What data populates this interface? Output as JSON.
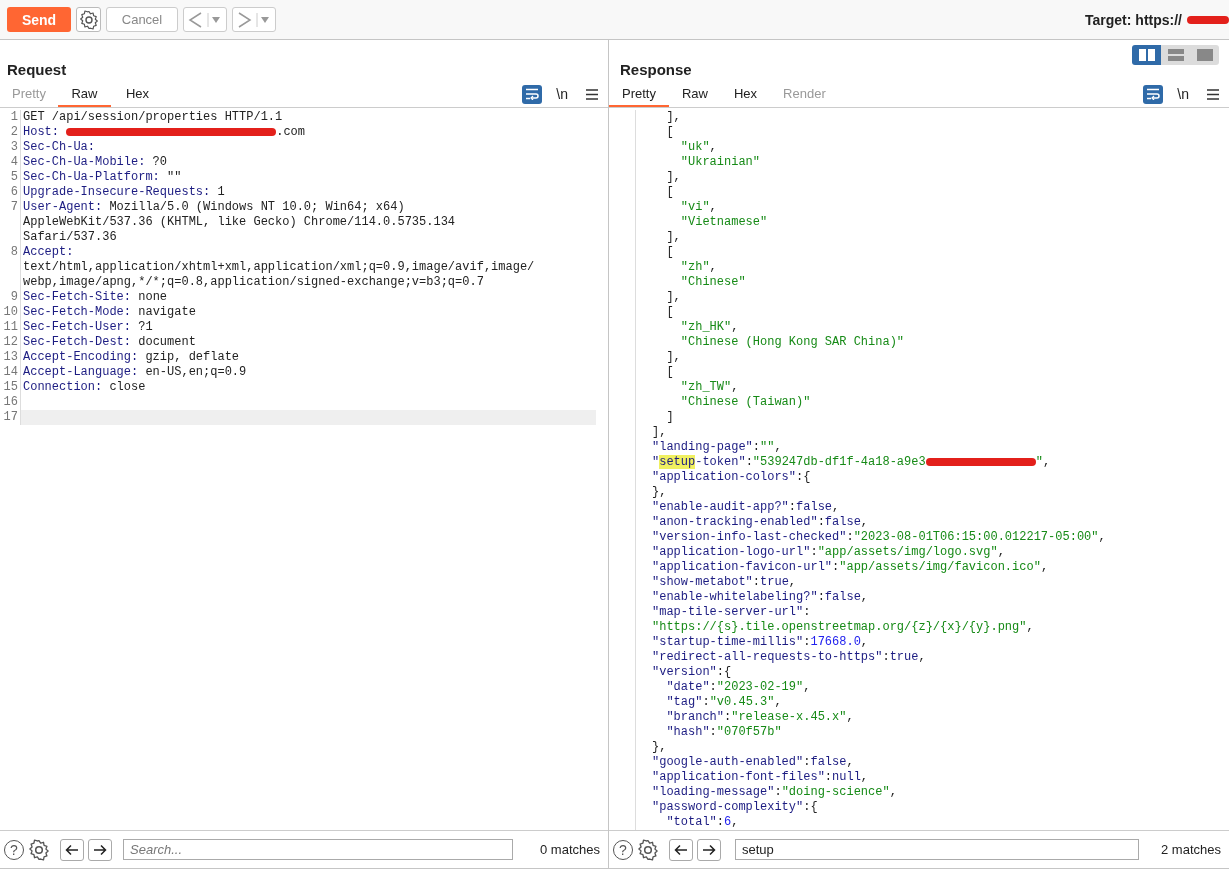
{
  "toolbar": {
    "send": "Send",
    "cancel": {
      "label": "Cancel",
      "disabled": true
    },
    "target": {
      "label": "Target: https://",
      "redacted": true
    }
  },
  "request": {
    "title": "Request",
    "tabs": [
      {
        "label": "Pretty",
        "selected": false,
        "disabled": true
      },
      {
        "label": "Raw",
        "selected": true,
        "disabled": false
      },
      {
        "label": "Hex",
        "selected": false,
        "disabled": false
      }
    ],
    "wrap_on": true,
    "newline_label": "\\n",
    "lines": [
      {
        "number": "1",
        "current": false,
        "parts": [
          {
            "kind": "plain",
            "text": "GET /api/session/properties HTTP/1.1"
          }
        ]
      },
      {
        "number": "2",
        "current": false,
        "parts": [
          {
            "kind": "key",
            "text": "Host: "
          },
          {
            "kind": "redacted"
          },
          {
            "kind": "plain",
            "text": ".com"
          }
        ]
      },
      {
        "number": "3",
        "current": false,
        "parts": [
          {
            "kind": "key",
            "text": "Sec-Ch-Ua:"
          }
        ]
      },
      {
        "number": "4",
        "current": false,
        "parts": [
          {
            "kind": "key",
            "text": "Sec-Ch-Ua-Mobile:"
          },
          {
            "kind": "plain",
            "text": " ?0"
          }
        ]
      },
      {
        "number": "5",
        "current": false,
        "parts": [
          {
            "kind": "key",
            "text": "Sec-Ch-Ua-Platform:"
          },
          {
            "kind": "plain",
            "text": " \"\""
          }
        ]
      },
      {
        "number": "6",
        "current": false,
        "parts": [
          {
            "kind": "key",
            "text": "Upgrade-Insecure-Requests:"
          },
          {
            "kind": "plain",
            "text": " 1"
          }
        ]
      },
      {
        "number": "7",
        "current": false,
        "parts": [
          {
            "kind": "key",
            "text": "User-Agent:"
          },
          {
            "kind": "plain",
            "text": " Mozilla/5.0 (Windows NT 10.0; Win64; x64)"
          }
        ]
      },
      {
        "current": false,
        "parts": [
          {
            "kind": "plain",
            "text": "AppleWebKit/537.36 (KHTML, like Gecko) Chrome/114.0.5735.134"
          }
        ]
      },
      {
        "current": false,
        "parts": [
          {
            "kind": "plain",
            "text": "Safari/537.36"
          }
        ]
      },
      {
        "number": "8",
        "current": false,
        "parts": [
          {
            "kind": "key",
            "text": "Accept:"
          }
        ]
      },
      {
        "current": false,
        "parts": [
          {
            "kind": "plain",
            "text": "text/html,application/xhtml+xml,application/xml;q=0.9,image/avif,image/"
          }
        ]
      },
      {
        "current": false,
        "parts": [
          {
            "kind": "plain",
            "text": "webp,image/apng,*/*;q=0.8,application/signed-exchange;v=b3;q=0.7"
          }
        ]
      },
      {
        "number": "9",
        "current": false,
        "parts": [
          {
            "kind": "key",
            "text": "Sec-Fetch-Site:"
          },
          {
            "kind": "plain",
            "text": " none"
          }
        ]
      },
      {
        "number": "10",
        "current": false,
        "parts": [
          {
            "kind": "key",
            "text": "Sec-Fetch-Mode:"
          },
          {
            "kind": "plain",
            "text": " navigate"
          }
        ]
      },
      {
        "number": "11",
        "current": false,
        "parts": [
          {
            "kind": "key",
            "text": "Sec-Fetch-User:"
          },
          {
            "kind": "plain",
            "text": " ?1"
          }
        ]
      },
      {
        "number": "12",
        "current": false,
        "parts": [
          {
            "kind": "key",
            "text": "Sec-Fetch-Dest:"
          },
          {
            "kind": "plain",
            "text": " document"
          }
        ]
      },
      {
        "number": "13",
        "current": false,
        "parts": [
          {
            "kind": "key",
            "text": "Accept-Encoding:"
          },
          {
            "kind": "plain",
            "text": " gzip, deflate"
          }
        ]
      },
      {
        "number": "14",
        "current": false,
        "parts": [
          {
            "kind": "key",
            "text": "Accept-Language:"
          },
          {
            "kind": "plain",
            "text": " en-US,en;q=0.9"
          }
        ]
      },
      {
        "number": "15",
        "current": false,
        "parts": [
          {
            "kind": "key",
            "text": "Connection:"
          },
          {
            "kind": "plain",
            "text": " close"
          }
        ]
      },
      {
        "number": "16",
        "current": false
      },
      {
        "number": "17",
        "current": true
      }
    ],
    "search": {
      "help": "?",
      "placeholder": "Search...",
      "matches": "0 matches"
    }
  },
  "response": {
    "title": "Response",
    "view_buttons": [
      {
        "kind": "columns",
        "selected": true
      },
      {
        "kind": "rows",
        "selected": false
      },
      {
        "kind": "single",
        "selected": false
      }
    ],
    "tabs": [
      {
        "label": "Pretty",
        "selected": true,
        "disabled": false
      },
      {
        "label": "Raw",
        "selected": false,
        "disabled": false
      },
      {
        "label": "Hex",
        "selected": false,
        "disabled": false
      },
      {
        "label": "Render",
        "selected": false,
        "disabled": true
      }
    ],
    "wrap_on": true,
    "newline_label": "\\n",
    "lines": [
      {
        "parts": [
          {
            "kind": "plain",
            "text": "  ],"
          }
        ]
      },
      {
        "parts": [
          {
            "kind": "plain",
            "text": "  ["
          }
        ]
      },
      {
        "parts": [
          {
            "kind": "str",
            "text": "    \"uk\""
          },
          {
            "kind": "plain",
            "text": ","
          }
        ]
      },
      {
        "parts": [
          {
            "kind": "str",
            "text": "    \"Ukrainian\""
          }
        ]
      },
      {
        "parts": [
          {
            "kind": "plain",
            "text": "  ],"
          }
        ]
      },
      {
        "parts": [
          {
            "kind": "plain",
            "text": "  ["
          }
        ]
      },
      {
        "parts": [
          {
            "kind": "str",
            "text": "    \"vi\""
          },
          {
            "kind": "plain",
            "text": ","
          }
        ]
      },
      {
        "parts": [
          {
            "kind": "str",
            "text": "    \"Vietnamese\""
          }
        ]
      },
      {
        "parts": [
          {
            "kind": "plain",
            "text": "  ],"
          }
        ]
      },
      {
        "parts": [
          {
            "kind": "plain",
            "text": "  ["
          }
        ]
      },
      {
        "parts": [
          {
            "kind": "str",
            "text": "    \"zh\""
          },
          {
            "kind": "plain",
            "text": ","
          }
        ]
      },
      {
        "parts": [
          {
            "kind": "str",
            "text": "    \"Chinese\""
          }
        ]
      },
      {
        "parts": [
          {
            "kind": "plain",
            "text": "  ],"
          }
        ]
      },
      {
        "parts": [
          {
            "kind": "plain",
            "text": "  ["
          }
        ]
      },
      {
        "parts": [
          {
            "kind": "str",
            "text": "    \"zh_HK\""
          },
          {
            "kind": "plain",
            "text": ","
          }
        ]
      },
      {
        "parts": [
          {
            "kind": "str",
            "text": "    \"Chinese (Hong Kong SAR China)\""
          }
        ]
      },
      {
        "parts": [
          {
            "kind": "plain",
            "text": "  ],"
          }
        ]
      },
      {
        "parts": [
          {
            "kind": "plain",
            "text": "  ["
          }
        ]
      },
      {
        "parts": [
          {
            "kind": "str",
            "text": "    \"zh_TW\""
          },
          {
            "kind": "plain",
            "text": ","
          }
        ]
      },
      {
        "parts": [
          {
            "kind": "str",
            "text": "    \"Chinese (Taiwan)\""
          }
        ]
      },
      {
        "parts": [
          {
            "kind": "plain",
            "text": "  ]"
          }
        ]
      },
      {
        "parts": [
          {
            "kind": "plain",
            "text": "],"
          }
        ]
      },
      {
        "parts": [
          {
            "kind": "key",
            "text": "\"landing-page\""
          },
          {
            "kind": "plain",
            "text": ":"
          },
          {
            "kind": "str",
            "text": "\"\""
          },
          {
            "kind": "plain",
            "text": ","
          }
        ]
      },
      {
        "parts": [
          {
            "kind": "key",
            "text": "\""
          },
          {
            "kind": "match",
            "text": "setup"
          },
          {
            "kind": "key",
            "text": "-token\""
          },
          {
            "kind": "plain",
            "text": ":"
          },
          {
            "kind": "str",
            "text": "\"539247db-df1f-4a18-a9e3"
          },
          {
            "kind": "redacted"
          },
          {
            "kind": "str",
            "text": "\""
          },
          {
            "kind": "plain",
            "text": ","
          }
        ]
      },
      {
        "parts": [
          {
            "kind": "key",
            "text": "\"application-colors\""
          },
          {
            "kind": "plain",
            "text": ":{"
          }
        ]
      },
      {
        "parts": [
          {
            "kind": "plain",
            "text": "},"
          }
        ]
      },
      {
        "parts": [
          {
            "kind": "key",
            "text": "\"enable-audit-app?\""
          },
          {
            "kind": "plain",
            "text": ":"
          },
          {
            "kind": "lit",
            "text": "false"
          },
          {
            "kind": "plain",
            "text": ","
          }
        ]
      },
      {
        "parts": [
          {
            "kind": "key",
            "text": "\"anon-tracking-enabled\""
          },
          {
            "kind": "plain",
            "text": ":"
          },
          {
            "kind": "lit",
            "text": "false"
          },
          {
            "kind": "plain",
            "text": ","
          }
        ]
      },
      {
        "parts": [
          {
            "kind": "key",
            "text": "\"version-info-last-checked\""
          },
          {
            "kind": "plain",
            "text": ":"
          },
          {
            "kind": "str",
            "text": "\"2023-08-01T06:15:00.012217-05:00\""
          },
          {
            "kind": "plain",
            "text": ","
          }
        ]
      },
      {
        "parts": [
          {
            "kind": "key",
            "text": "\"application-logo-url\""
          },
          {
            "kind": "plain",
            "text": ":"
          },
          {
            "kind": "str",
            "text": "\"app/assets/img/logo.svg\""
          },
          {
            "kind": "plain",
            "text": ","
          }
        ]
      },
      {
        "parts": [
          {
            "kind": "key",
            "text": "\"application-favicon-url\""
          },
          {
            "kind": "plain",
            "text": ":"
          },
          {
            "kind": "str",
            "text": "\"app/assets/img/favicon.ico\""
          },
          {
            "kind": "plain",
            "text": ","
          }
        ]
      },
      {
        "parts": [
          {
            "kind": "key",
            "text": "\"show-metabot\""
          },
          {
            "kind": "plain",
            "text": ":"
          },
          {
            "kind": "lit",
            "text": "true"
          },
          {
            "kind": "plain",
            "text": ","
          }
        ]
      },
      {
        "parts": [
          {
            "kind": "key",
            "text": "\"enable-whitelabeling?\""
          },
          {
            "kind": "plain",
            "text": ":"
          },
          {
            "kind": "lit",
            "text": "false"
          },
          {
            "kind": "plain",
            "text": ","
          }
        ]
      },
      {
        "parts": [
          {
            "kind": "key",
            "text": "\"map-tile-server-url\""
          },
          {
            "kind": "plain",
            "text": ":"
          }
        ]
      },
      {
        "parts": [
          {
            "kind": "str",
            "text": "\"https://{s}.tile.openstreetmap.org/{z}/{x}/{y}.png\""
          },
          {
            "kind": "plain",
            "text": ","
          }
        ]
      },
      {
        "parts": [
          {
            "kind": "key",
            "text": "\"startup-time-millis\""
          },
          {
            "kind": "plain",
            "text": ":"
          },
          {
            "kind": "num",
            "text": "17668.0"
          },
          {
            "kind": "plain",
            "text": ","
          }
        ]
      },
      {
        "parts": [
          {
            "kind": "key",
            "text": "\"redirect-all-requests-to-https\""
          },
          {
            "kind": "plain",
            "text": ":"
          },
          {
            "kind": "lit",
            "text": "true"
          },
          {
            "kind": "plain",
            "text": ","
          }
        ]
      },
      {
        "parts": [
          {
            "kind": "key",
            "text": "\"version\""
          },
          {
            "kind": "plain",
            "text": ":{"
          }
        ]
      },
      {
        "parts": [
          {
            "kind": "key",
            "text": "  \"date\""
          },
          {
            "kind": "plain",
            "text": ":"
          },
          {
            "kind": "str",
            "text": "\"2023-02-19\""
          },
          {
            "kind": "plain",
            "text": ","
          }
        ]
      },
      {
        "parts": [
          {
            "kind": "key",
            "text": "  \"tag\""
          },
          {
            "kind": "plain",
            "text": ":"
          },
          {
            "kind": "str",
            "text": "\"v0.45.3\""
          },
          {
            "kind": "plain",
            "text": ","
          }
        ]
      },
      {
        "parts": [
          {
            "kind": "key",
            "text": "  \"branch\""
          },
          {
            "kind": "plain",
            "text": ":"
          },
          {
            "kind": "str",
            "text": "\"release-x.45.x\""
          },
          {
            "kind": "plain",
            "text": ","
          }
        ]
      },
      {
        "parts": [
          {
            "kind": "key",
            "text": "  \"hash\""
          },
          {
            "kind": "plain",
            "text": ":"
          },
          {
            "kind": "str",
            "text": "\"070f57b\""
          }
        ]
      },
      {
        "parts": [
          {
            "kind": "plain",
            "text": "},"
          }
        ]
      },
      {
        "parts": [
          {
            "kind": "key",
            "text": "\"google-auth-enabled\""
          },
          {
            "kind": "plain",
            "text": ":"
          },
          {
            "kind": "lit",
            "text": "false"
          },
          {
            "kind": "plain",
            "text": ","
          }
        ]
      },
      {
        "parts": [
          {
            "kind": "key",
            "text": "\"application-font-files\""
          },
          {
            "kind": "plain",
            "text": ":"
          },
          {
            "kind": "lit",
            "text": "null"
          },
          {
            "kind": "plain",
            "text": ","
          }
        ]
      },
      {
        "parts": [
          {
            "kind": "key",
            "text": "\"loading-message\""
          },
          {
            "kind": "plain",
            "text": ":"
          },
          {
            "kind": "str",
            "text": "\"doing-science\""
          },
          {
            "kind": "plain",
            "text": ","
          }
        ]
      },
      {
        "parts": [
          {
            "kind": "key",
            "text": "\"password-complexity\""
          },
          {
            "kind": "plain",
            "text": ":{"
          }
        ]
      },
      {
        "parts": [
          {
            "kind": "key",
            "text": "  \"total\""
          },
          {
            "kind": "plain",
            "text": ":"
          },
          {
            "kind": "num",
            "text": "6"
          },
          {
            "kind": "plain",
            "text": ","
          }
        ]
      }
    ],
    "search": {
      "help": "?",
      "value": "setup",
      "matches": "2 matches"
    }
  }
}
